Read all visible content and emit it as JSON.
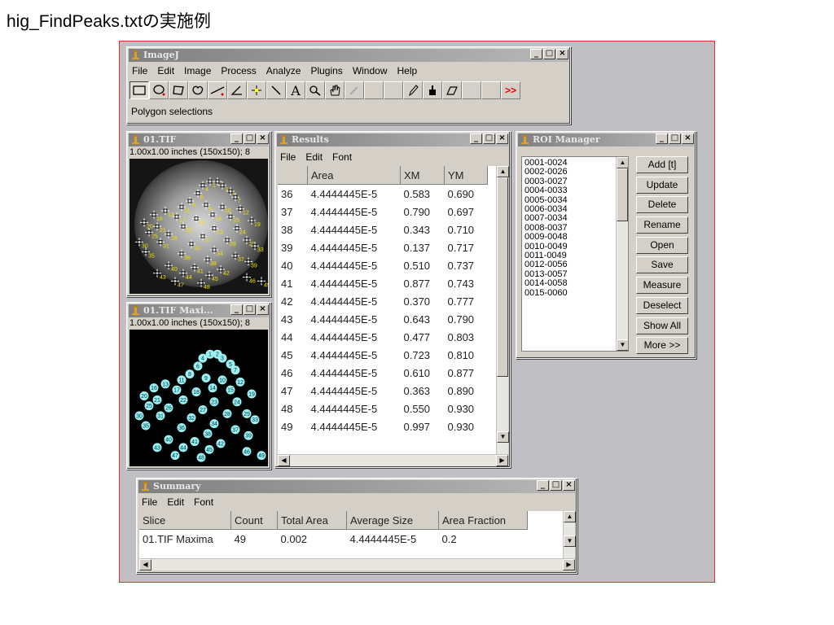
{
  "page_title": "hig_FindPeaks.txtの実施例",
  "imagej": {
    "title": "ImageJ",
    "menu": [
      "File",
      "Edit",
      "Image",
      "Process",
      "Analyze",
      "Plugins",
      "Window",
      "Help"
    ],
    "status": "Polygon selections",
    "tools": [
      "rectangle-tool-icon",
      "oval-tool-icon",
      "polygon-tool-icon",
      "freehand-tool-icon",
      "line-tool-icon",
      "angle-tool-icon",
      "point-tool-icon",
      "wand-tool-icon",
      "text-tool-icon",
      "magnifier-tool-icon",
      "hand-tool-icon",
      "dropper-tool-icon",
      "blank-tool-1",
      "blank-tool-2",
      "pencil-tool-icon",
      "brush-tool-icon",
      "eraser-tool-icon",
      "blank-tool-3",
      "blank-tool-4",
      "more-tools-icon"
    ]
  },
  "image1": {
    "title": "01.TIF",
    "info": "1.00x1.00 inches (150x150); 8"
  },
  "image2": {
    "title": "01.TIF Maxi...",
    "info": "1.00x1.00 inches (150x150); 8"
  },
  "results": {
    "title": "Results",
    "menu": [
      "File",
      "Edit",
      "Font"
    ],
    "columns": [
      "",
      "Area",
      "XM",
      "YM"
    ],
    "rows": [
      [
        "36",
        "4.4444445E-5",
        "0.583",
        "0.690"
      ],
      [
        "37",
        "4.4444445E-5",
        "0.790",
        "0.697"
      ],
      [
        "38",
        "4.4444445E-5",
        "0.343",
        "0.710"
      ],
      [
        "39",
        "4.4444445E-5",
        "0.137",
        "0.717"
      ],
      [
        "40",
        "4.4444445E-5",
        "0.510",
        "0.737"
      ],
      [
        "41",
        "4.4444445E-5",
        "0.877",
        "0.743"
      ],
      [
        "42",
        "4.4444445E-5",
        "0.370",
        "0.777"
      ],
      [
        "43",
        "4.4444445E-5",
        "0.643",
        "0.790"
      ],
      [
        "44",
        "4.4444445E-5",
        "0.477",
        "0.803"
      ],
      [
        "45",
        "4.4444445E-5",
        "0.723",
        "0.810"
      ],
      [
        "46",
        "4.4444445E-5",
        "0.610",
        "0.877"
      ],
      [
        "47",
        "4.4444445E-5",
        "0.363",
        "0.890"
      ],
      [
        "48",
        "4.4444445E-5",
        "0.550",
        "0.930"
      ],
      [
        "49",
        "4.4444445E-5",
        "0.997",
        "0.930"
      ]
    ]
  },
  "roi_manager": {
    "title": "ROI Manager",
    "items": [
      "0001-0024",
      "0002-0026",
      "0003-0027",
      "0004-0033",
      "0005-0034",
      "0006-0034",
      "0007-0034",
      "0008-0037",
      "0009-0048",
      "0010-0049",
      "0011-0049",
      "0012-0056",
      "0013-0057",
      "0014-0058",
      "0015-0060"
    ],
    "buttons": [
      "Add [t]",
      "Update",
      "Delete",
      "Rename",
      "Open",
      "Save",
      "Measure",
      "Deselect",
      "Show All",
      "More >>"
    ]
  },
  "summary": {
    "title": "Summary",
    "menu": [
      "File",
      "Edit",
      "Font"
    ],
    "columns": [
      "Slice",
      "Count",
      "Total Area",
      "Average Size",
      "Area Fraction"
    ],
    "row": [
      "01.TIF Maxima",
      "49",
      "0.002",
      "4.4444445E-5",
      "0.2"
    ]
  },
  "maxima_labels": [
    "1",
    "2",
    "3",
    "4",
    "5",
    "6",
    "7",
    "8",
    "9",
    "10",
    "11",
    "12",
    "13",
    "14",
    "15",
    "16",
    "17",
    "18",
    "19",
    "20",
    "21",
    "22",
    "23",
    "24",
    "25",
    "26",
    "27",
    "28",
    "29",
    "30",
    "31",
    "32",
    "33",
    "34",
    "35",
    "36",
    "37",
    "38",
    "39",
    "40",
    "41",
    "42",
    "43",
    "44",
    "45",
    "46",
    "47",
    "48",
    "49"
  ],
  "colors": {
    "frame_border": "#e03030",
    "desktop": "#c0c0c4",
    "window": "#d4d0c8",
    "marker_yellow": "#f0e000",
    "maxima_cyan": "#9cf0f0"
  }
}
